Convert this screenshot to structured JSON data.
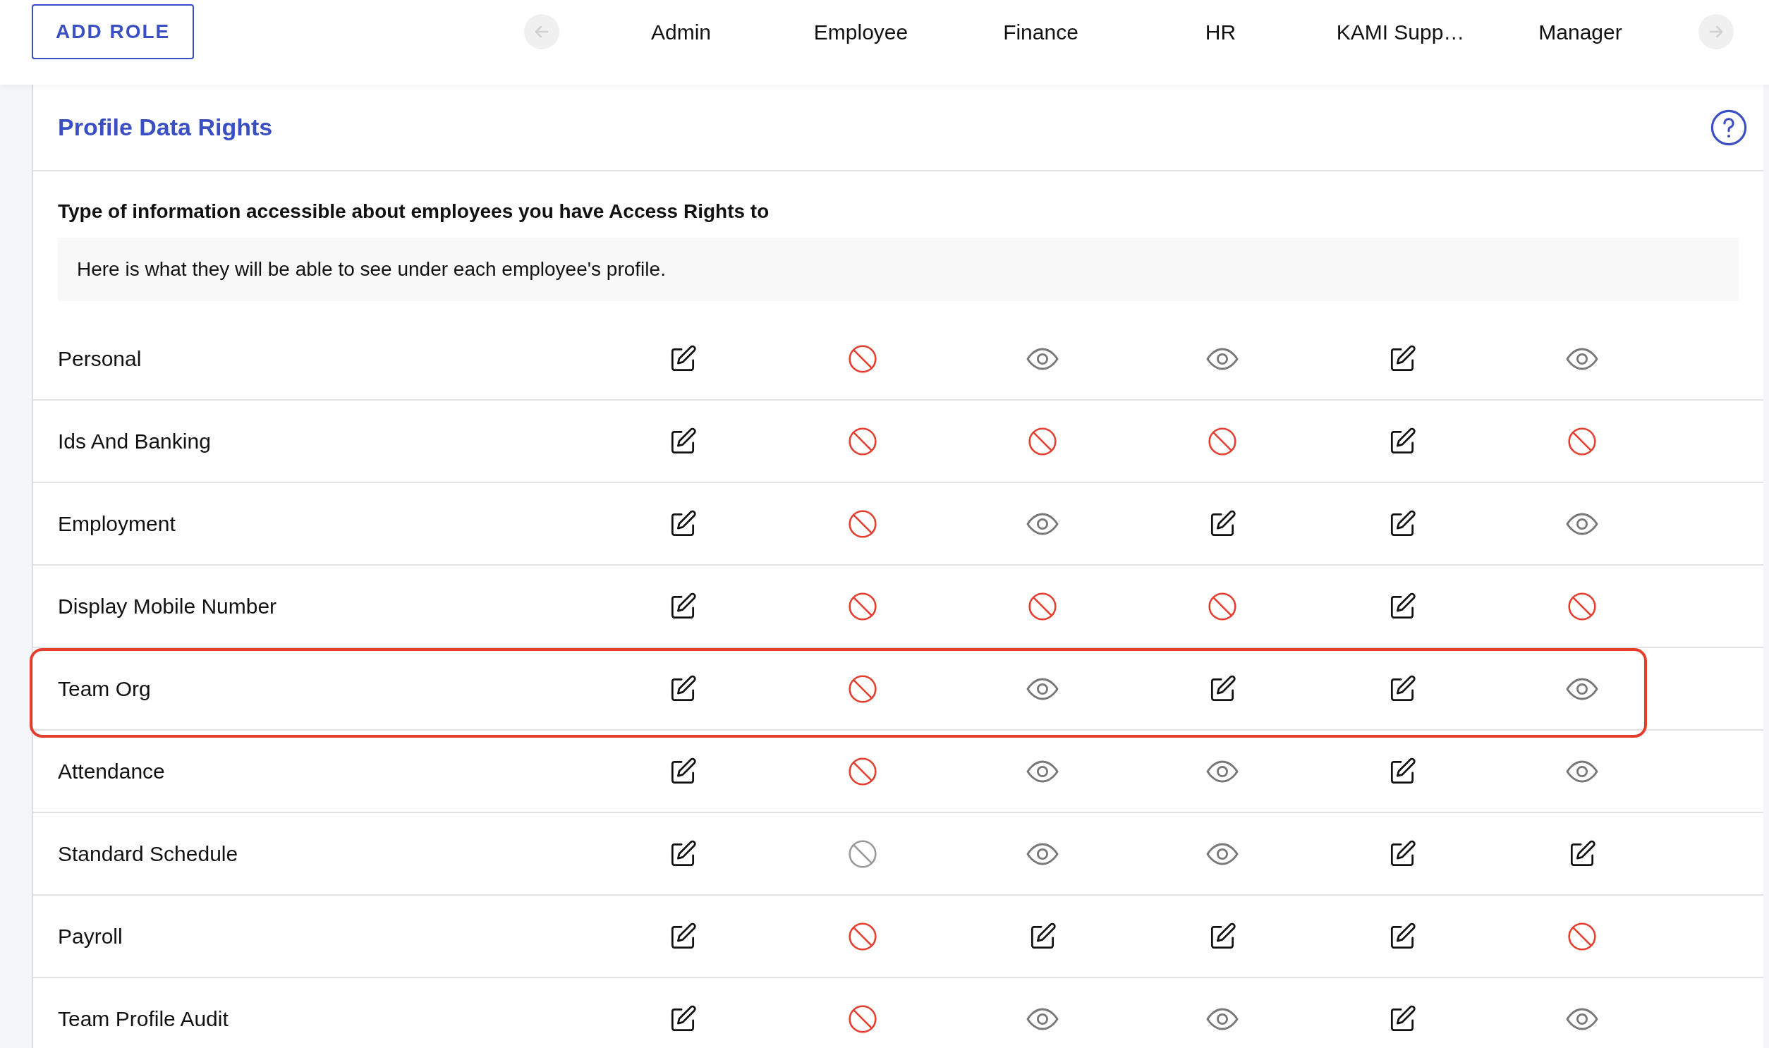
{
  "toolbar": {
    "add_button": "ADD ROLE",
    "roles": [
      "Admin",
      "Employee",
      "Finance",
      "HR",
      "KAMI Supp…",
      "Manager"
    ]
  },
  "card": {
    "title": "Profile Data Rights",
    "subtitle": "Type of information accessible about employees you have Access Rights to",
    "note": "Here is what they will be able to see under each employee's profile.",
    "rows": [
      {
        "label": "Personal",
        "highlighted": false,
        "cells": [
          {
            "kind": "edit",
            "disabled": false
          },
          {
            "kind": "none",
            "disabled": false
          },
          {
            "kind": "view",
            "disabled": false
          },
          {
            "kind": "view",
            "disabled": false
          },
          {
            "kind": "edit",
            "disabled": false
          },
          {
            "kind": "view",
            "disabled": false
          }
        ]
      },
      {
        "label": "Ids And Banking",
        "highlighted": false,
        "cells": [
          {
            "kind": "edit",
            "disabled": false
          },
          {
            "kind": "none",
            "disabled": false
          },
          {
            "kind": "none",
            "disabled": false
          },
          {
            "kind": "none",
            "disabled": false
          },
          {
            "kind": "edit",
            "disabled": false
          },
          {
            "kind": "none",
            "disabled": false
          }
        ]
      },
      {
        "label": "Employment",
        "highlighted": false,
        "cells": [
          {
            "kind": "edit",
            "disabled": false
          },
          {
            "kind": "none",
            "disabled": false
          },
          {
            "kind": "view",
            "disabled": false
          },
          {
            "kind": "edit",
            "disabled": false
          },
          {
            "kind": "edit",
            "disabled": false
          },
          {
            "kind": "view",
            "disabled": false
          }
        ]
      },
      {
        "label": "Display Mobile Number",
        "highlighted": false,
        "cells": [
          {
            "kind": "edit",
            "disabled": false
          },
          {
            "kind": "none",
            "disabled": false
          },
          {
            "kind": "none",
            "disabled": false
          },
          {
            "kind": "none",
            "disabled": false
          },
          {
            "kind": "edit",
            "disabled": false
          },
          {
            "kind": "none",
            "disabled": false
          }
        ]
      },
      {
        "label": "Team Org",
        "highlighted": true,
        "cells": [
          {
            "kind": "edit",
            "disabled": false
          },
          {
            "kind": "none",
            "disabled": false
          },
          {
            "kind": "view",
            "disabled": false
          },
          {
            "kind": "edit",
            "disabled": false
          },
          {
            "kind": "edit",
            "disabled": false
          },
          {
            "kind": "view",
            "disabled": false
          }
        ]
      },
      {
        "label": "Attendance",
        "highlighted": false,
        "cells": [
          {
            "kind": "edit",
            "disabled": false
          },
          {
            "kind": "none",
            "disabled": false
          },
          {
            "kind": "view",
            "disabled": false
          },
          {
            "kind": "view",
            "disabled": false
          },
          {
            "kind": "edit",
            "disabled": false
          },
          {
            "kind": "view",
            "disabled": false
          }
        ]
      },
      {
        "label": "Standard Schedule",
        "highlighted": false,
        "cells": [
          {
            "kind": "edit",
            "disabled": false
          },
          {
            "kind": "none",
            "disabled": true
          },
          {
            "kind": "view",
            "disabled": false
          },
          {
            "kind": "view",
            "disabled": false
          },
          {
            "kind": "edit",
            "disabled": false
          },
          {
            "kind": "edit",
            "disabled": false
          }
        ]
      },
      {
        "label": "Payroll",
        "highlighted": false,
        "cells": [
          {
            "kind": "edit",
            "disabled": false
          },
          {
            "kind": "none",
            "disabled": false
          },
          {
            "kind": "edit",
            "disabled": false
          },
          {
            "kind": "edit",
            "disabled": false
          },
          {
            "kind": "edit",
            "disabled": false
          },
          {
            "kind": "none",
            "disabled": false
          }
        ]
      },
      {
        "label": "Team Profile Audit",
        "highlighted": false,
        "cells": [
          {
            "kind": "edit",
            "disabled": false
          },
          {
            "kind": "none",
            "disabled": false
          },
          {
            "kind": "view",
            "disabled": false
          },
          {
            "kind": "view",
            "disabled": false
          },
          {
            "kind": "edit",
            "disabled": false
          },
          {
            "kind": "view",
            "disabled": false
          }
        ]
      }
    ]
  }
}
